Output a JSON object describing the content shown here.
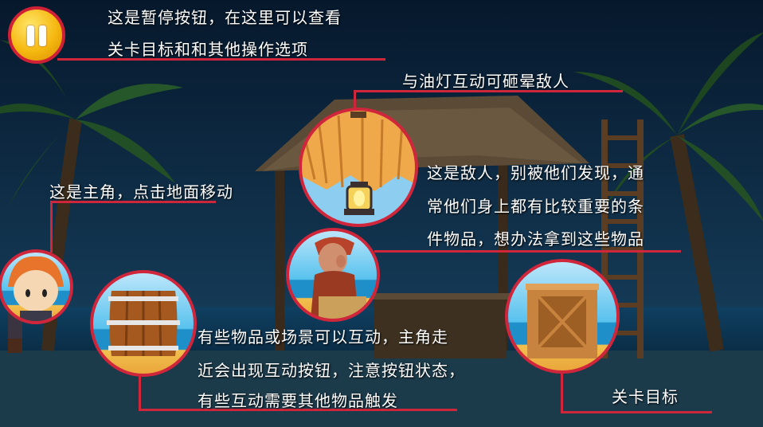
{
  "tutorial": {
    "pause_line1": "这是暂停按钮，在这里可以查看",
    "pause_line2": "关卡目标和和其他操作选项",
    "lamp_tip": "与油灯互动可砸晕敌人",
    "hero_tip": "这是主角，点击地面移动",
    "enemy_line1": "这是敌人，别被他们发现，通",
    "enemy_line2": "常他们身上都有比较重要的条",
    "enemy_line3": "件物品，想办法拿到这些物品",
    "interact_line1": "有些物品或场景可以互动，主角走",
    "interact_line2": "近会出现互动按钮，注意按钮状态，",
    "interact_line3": "有些互动需要其他物品触发",
    "goal_tip": "关卡目标"
  },
  "colors": {
    "sky": "#0c2a44",
    "accent_red": "#d0263c",
    "pause_yellow": "#f5b810",
    "sea": "#2aa6d8",
    "sand": "#f2b84a"
  },
  "icons": [
    "pause-icon",
    "lamp-icon",
    "hero-icon",
    "enemy-icon",
    "barrel-icon",
    "crate-icon"
  ]
}
